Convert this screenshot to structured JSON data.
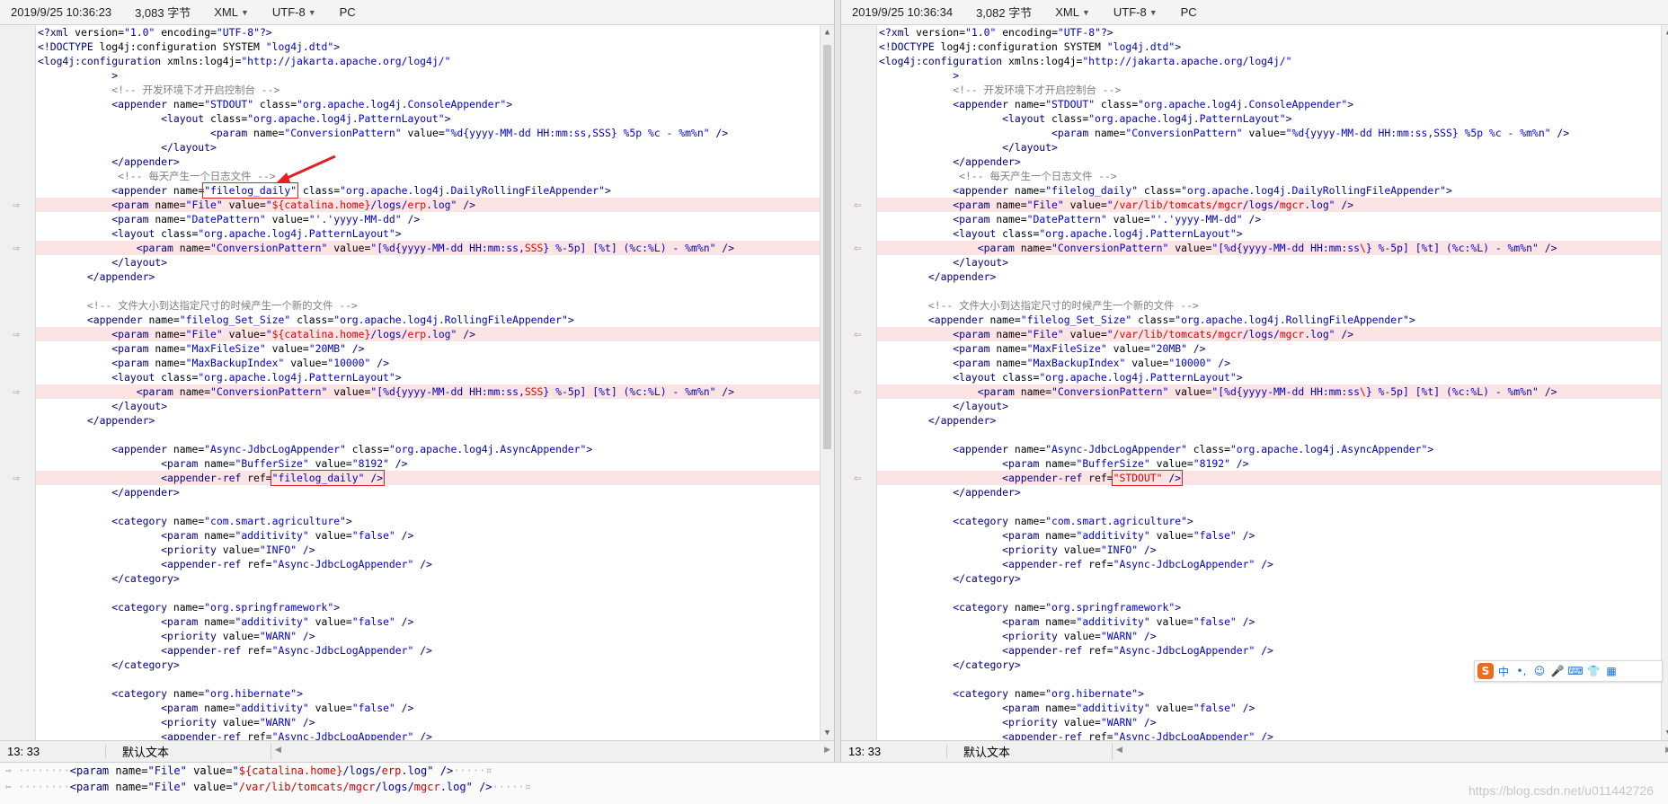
{
  "left": {
    "datetime": "2019/9/25 10:36:23",
    "size": "3,083 字节",
    "syntax": "XML",
    "encoding": "UTF-8",
    "lineending": "PC",
    "cursor": "13: 33",
    "mode": "默认文本",
    "lines": [
      {
        "t": "<?xml version=\"1.0\" encoding=\"UTF-8\"?>"
      },
      {
        "t": "<!DOCTYPE log4j:configuration SYSTEM \"log4j.dtd\">"
      },
      {
        "t": "<log4j:configuration xmlns:log4j=\"http://jakarta.apache.org/log4j/\""
      },
      {
        "t": "            >"
      },
      {
        "t": "            <!-- 开发环境下才开启控制台 -->"
      },
      {
        "t": "            <appender name=\"STDOUT\" class=\"org.apache.log4j.ConsoleAppender\">"
      },
      {
        "t": "                    <layout class=\"org.apache.log4j.PatternLayout\">"
      },
      {
        "t": "                            <param name=\"ConversionPattern\" value=\"%d{yyyy-MM-dd HH:mm:ss,SSS} %5p %c - %m%n\" />"
      },
      {
        "t": "                    </layout>"
      },
      {
        "t": "            </appender>"
      },
      {
        "t": "             <!-- 每天产生一个日志文件 -->"
      },
      {
        "t": "            <appender name=\"filelog_daily\" class=\"org.apache.log4j.DailyRollingFileAppender\">"
      },
      {
        "t": "            <param name=\"File\" value=\"${catalina.home}/logs/erp.log\" />",
        "diff": true
      },
      {
        "t": "            <param name=\"DatePattern\" value=\"'.'yyyy-MM-dd\" />"
      },
      {
        "t": "            <layout class=\"org.apache.log4j.PatternLayout\">"
      },
      {
        "t": "                <param name=\"ConversionPattern\" value=\"[%d{yyyy-MM-dd HH:mm:ss,SSS} %-5p] [%t] (%c:%L) - %m%n\" />",
        "diff": true
      },
      {
        "t": "            </layout>"
      },
      {
        "t": "        </appender>"
      },
      {
        "t": ""
      },
      {
        "t": "        <!-- 文件大小到达指定尺寸的时候产生一个新的文件 -->"
      },
      {
        "t": "        <appender name=\"filelog_Set_Size\" class=\"org.apache.log4j.RollingFileAppender\">"
      },
      {
        "t": "            <param name=\"File\" value=\"${catalina.home}/logs/erp.log\" />",
        "diff": true
      },
      {
        "t": "            <param name=\"MaxFileSize\" value=\"20MB\" />"
      },
      {
        "t": "            <param name=\"MaxBackupIndex\" value=\"10000\" />"
      },
      {
        "t": "            <layout class=\"org.apache.log4j.PatternLayout\">"
      },
      {
        "t": "                <param name=\"ConversionPattern\" value=\"[%d{yyyy-MM-dd HH:mm:ss,SSS} %-5p] [%t] (%c:%L) - %m%n\" />",
        "diff": true
      },
      {
        "t": "            </layout>"
      },
      {
        "t": "        </appender>"
      },
      {
        "t": ""
      },
      {
        "t": "            <appender name=\"Async-JdbcLogAppender\" class=\"org.apache.log4j.AsyncAppender\">"
      },
      {
        "t": "                    <param name=\"BufferSize\" value=\"8192\" />"
      },
      {
        "t": "                    <appender-ref ref=\"filelog_daily\" />",
        "diff": true
      },
      {
        "t": "            </appender>"
      },
      {
        "t": ""
      },
      {
        "t": "            <category name=\"com.smart.agriculture\">"
      },
      {
        "t": "                    <param name=\"additivity\" value=\"false\" />"
      },
      {
        "t": "                    <priority value=\"INFO\" />"
      },
      {
        "t": "                    <appender-ref ref=\"Async-JdbcLogAppender\" />"
      },
      {
        "t": "            </category>"
      },
      {
        "t": ""
      },
      {
        "t": "            <category name=\"org.springframework\">"
      },
      {
        "t": "                    <param name=\"additivity\" value=\"false\" />"
      },
      {
        "t": "                    <priority value=\"WARN\" />"
      },
      {
        "t": "                    <appender-ref ref=\"Async-JdbcLogAppender\" />"
      },
      {
        "t": "            </category>"
      },
      {
        "t": ""
      },
      {
        "t": "            <category name=\"org.hibernate\">"
      },
      {
        "t": "                    <param name=\"additivity\" value=\"false\" />"
      },
      {
        "t": "                    <priority value=\"WARN\" />"
      },
      {
        "t": "                    <appender-ref ref=\"Async-JdbcLogAppender\" />"
      }
    ]
  },
  "right": {
    "datetime": "2019/9/25 10:36:34",
    "size": "3,082 字节",
    "syntax": "XML",
    "encoding": "UTF-8",
    "lineending": "PC",
    "cursor": "13: 33",
    "mode": "默认文本",
    "lines": [
      {
        "t": "<?xml version=\"1.0\" encoding=\"UTF-8\"?>"
      },
      {
        "t": "<!DOCTYPE log4j:configuration SYSTEM \"log4j.dtd\">"
      },
      {
        "t": "<log4j:configuration xmlns:log4j=\"http://jakarta.apache.org/log4j/\""
      },
      {
        "t": "            >"
      },
      {
        "t": "            <!-- 开发环境下才开启控制台 -->"
      },
      {
        "t": "            <appender name=\"STDOUT\" class=\"org.apache.log4j.ConsoleAppender\">"
      },
      {
        "t": "                    <layout class=\"org.apache.log4j.PatternLayout\">"
      },
      {
        "t": "                            <param name=\"ConversionPattern\" value=\"%d{yyyy-MM-dd HH:mm:ss,SSS} %5p %c - %m%n\" />"
      },
      {
        "t": "                    </layout>"
      },
      {
        "t": "            </appender>"
      },
      {
        "t": "             <!-- 每天产生一个日志文件 -->"
      },
      {
        "t": "            <appender name=\"filelog_daily\" class=\"org.apache.log4j.DailyRollingFileAppender\">"
      },
      {
        "t": "            <param name=\"File\" value=\"/var/lib/tomcats/mgcr/logs/mgcr.log\" />",
        "diff": true
      },
      {
        "t": "            <param name=\"DatePattern\" value=\"'.'yyyy-MM-dd\" />"
      },
      {
        "t": "            <layout class=\"org.apache.log4j.PatternLayout\">"
      },
      {
        "t": "                <param name=\"ConversionPattern\" value=\"[%d{yyyy-MM-dd HH:mm:ss\\} %-5p] [%t] (%c:%L) - %m%n\" />",
        "diff": true
      },
      {
        "t": "            </layout>"
      },
      {
        "t": "        </appender>"
      },
      {
        "t": ""
      },
      {
        "t": "        <!-- 文件大小到达指定尺寸的时候产生一个新的文件 -->"
      },
      {
        "t": "        <appender name=\"filelog_Set_Size\" class=\"org.apache.log4j.RollingFileAppender\">"
      },
      {
        "t": "            <param name=\"File\" value=\"/var/lib/tomcats/mgcr/logs/mgcr.log\" />",
        "diff": true
      },
      {
        "t": "            <param name=\"MaxFileSize\" value=\"20MB\" />"
      },
      {
        "t": "            <param name=\"MaxBackupIndex\" value=\"10000\" />"
      },
      {
        "t": "            <layout class=\"org.apache.log4j.PatternLayout\">"
      },
      {
        "t": "                <param name=\"ConversionPattern\" value=\"[%d{yyyy-MM-dd HH:mm:ss\\} %-5p] [%t] (%c:%L) - %m%n\" />",
        "diff": true
      },
      {
        "t": "            </layout>"
      },
      {
        "t": "        </appender>"
      },
      {
        "t": ""
      },
      {
        "t": "            <appender name=\"Async-JdbcLogAppender\" class=\"org.apache.log4j.AsyncAppender\">"
      },
      {
        "t": "                    <param name=\"BufferSize\" value=\"8192\" />"
      },
      {
        "t": "                    <appender-ref ref=\"STDOUT\" />",
        "diff": true
      },
      {
        "t": "            </appender>"
      },
      {
        "t": ""
      },
      {
        "t": "            <category name=\"com.smart.agriculture\">"
      },
      {
        "t": "                    <param name=\"additivity\" value=\"false\" />"
      },
      {
        "t": "                    <priority value=\"INFO\" />"
      },
      {
        "t": "                    <appender-ref ref=\"Async-JdbcLogAppender\" />"
      },
      {
        "t": "            </category>"
      },
      {
        "t": ""
      },
      {
        "t": "            <category name=\"org.springframework\">"
      },
      {
        "t": "                    <param name=\"additivity\" value=\"false\" />"
      },
      {
        "t": "                    <priority value=\"WARN\" />"
      },
      {
        "t": "                    <appender-ref ref=\"Async-JdbcLogAppender\" />"
      },
      {
        "t": "            </category>"
      },
      {
        "t": ""
      },
      {
        "t": "            <category name=\"org.hibernate\">"
      },
      {
        "t": "                    <param name=\"additivity\" value=\"false\" />"
      },
      {
        "t": "                    <priority value=\"WARN\" />"
      },
      {
        "t": "                    <appender-ref ref=\"Async-JdbcLogAppender\" />"
      }
    ]
  },
  "compare": {
    "line_left": "<param name=\"File\" value=\"${catalina.home}/logs/erp.log\" />",
    "line_right": "<param name=\"File\" value=\"/var/lib/tomcats/mgcr/logs/mgcr.log\" />"
  },
  "ime": {
    "items": [
      "S",
      "中",
      "•,",
      "☺",
      "🎤",
      "⌨",
      "👕",
      "▦"
    ]
  },
  "watermark": "https://blog.csdn.net/u011442726",
  "colors": {
    "diff_bg": "#fde4e4",
    "highlight": "#e00000",
    "marker": "#c9a000"
  }
}
